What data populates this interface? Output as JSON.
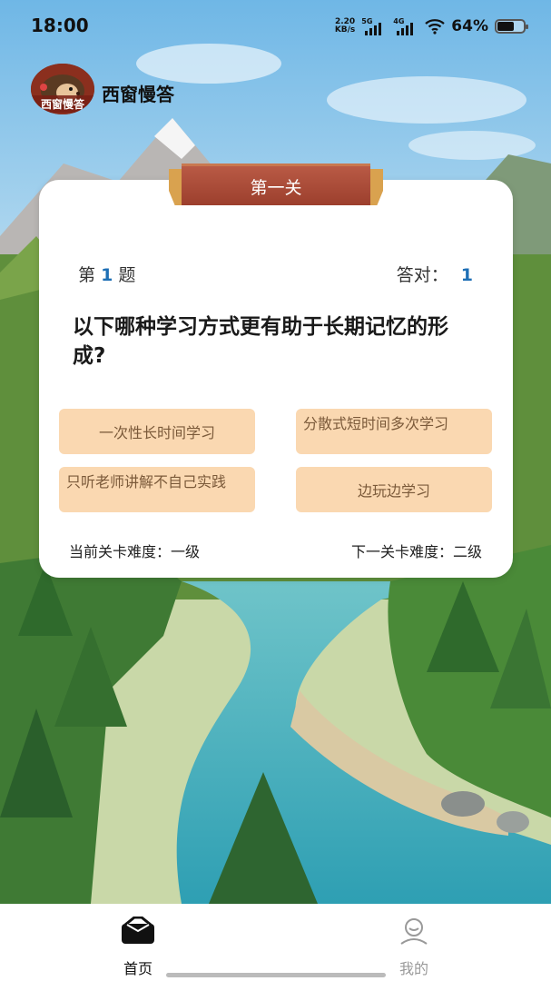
{
  "status_bar": {
    "time": "18:00",
    "speed_value": "2.20",
    "speed_unit": "KB/s",
    "net1": "5G",
    "net2": "4G",
    "battery_pct": "64%",
    "battery_level": 0.64,
    "icons": [
      "signal-icon",
      "wifi-icon",
      "battery-icon"
    ]
  },
  "header": {
    "avatar_caption": "西窗慢答",
    "app_name": "西窗慢答"
  },
  "card": {
    "level_title": "第一关",
    "question_prefix": "第",
    "question_number": "1",
    "question_suffix": "题",
    "correct_label": "答对：",
    "correct_count": "1",
    "question_text": "以下哪种学习方式更有助于长期记忆的形成?",
    "options": [
      "一次性长时间学习",
      "分散式短时间多次学习",
      "只听老师讲解不自己实践",
      "边玩边学习"
    ],
    "current_difficulty": "当前关卡难度：一级",
    "next_difficulty": "下一关卡难度：二级"
  },
  "colors": {
    "accent_blue": "#1e6fb5",
    "option_bg": "#fad8b1",
    "option_text": "#7b5a3a",
    "banner": "#a8473a",
    "nav_active": "#111111",
    "nav_inactive": "#999999"
  },
  "bottom_nav": {
    "items": [
      {
        "label": "首页",
        "icon": "home-icon",
        "active": true
      },
      {
        "label": "我的",
        "icon": "profile-icon",
        "active": false
      }
    ]
  }
}
